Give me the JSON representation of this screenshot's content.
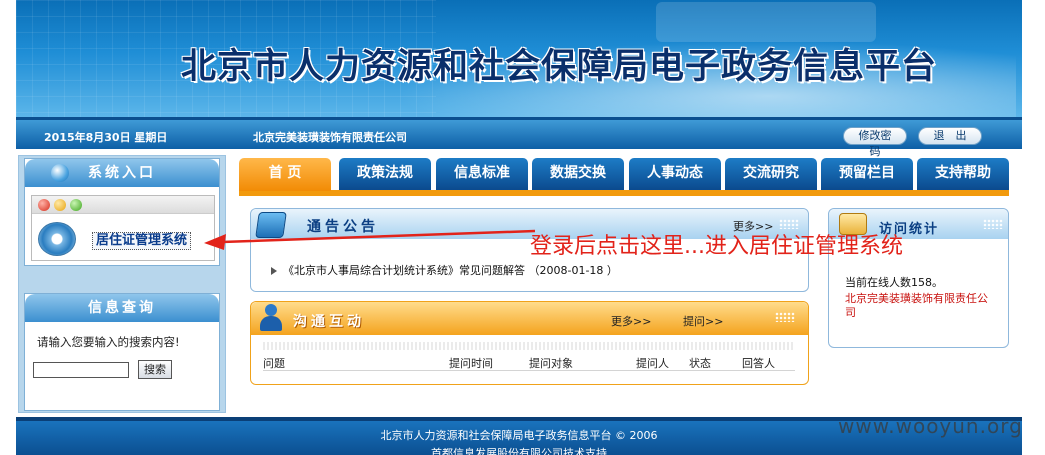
{
  "banner": {
    "title": "北京市人力资源和社会保障局电子政务信息平台"
  },
  "infobar": {
    "date": "2015年8月30日  星期日",
    "company": "北京完美装璜装饰有限责任公司",
    "change_password": "修改密码",
    "logout": "退　出"
  },
  "nav": {
    "tabs": [
      "首 页",
      "政策法规",
      "信息标准",
      "数据交换",
      "人事动态",
      "交流研究",
      "预留栏目",
      "支持帮助"
    ],
    "active_index": 0
  },
  "system_entry": {
    "title": "系统入口",
    "link": "居住证管理系统"
  },
  "search": {
    "title": "信息查询",
    "prompt": "请输入您要输入的搜索内容!",
    "input_value": "",
    "button": "搜索"
  },
  "notice": {
    "title": "通告公告",
    "more": "更多>>",
    "items": [
      "《北京市人事局综合计划统计系统》常见问题解答  （2008-01-18 ）"
    ]
  },
  "interaction": {
    "title": "沟通互动",
    "more": "更多>>",
    "ask": "提问>>",
    "columns": [
      "问题",
      "提问时间",
      "提问对象",
      "提问人",
      "状态",
      "回答人"
    ]
  },
  "stats": {
    "title": "访问统计",
    "online": "当前在线人数158。",
    "company": "北京完美装璜装饰有限责任公司"
  },
  "annotation": {
    "text": "登录后点击这里...进入居住证管理系统"
  },
  "footer": {
    "line1": "北京市人力资源和社会保障局电子政务信息平台 © 2006",
    "line2": "首都信息发展股份有限公司技术支持"
  },
  "watermark": "www.wooyun.org",
  "colors": {
    "banner_blue": "#1f8ed6",
    "tab_active": "#f28b05",
    "tab_normal": "#0b4a8e",
    "annotation_red": "#e2231a",
    "stats_company_red": "#c8120f"
  }
}
